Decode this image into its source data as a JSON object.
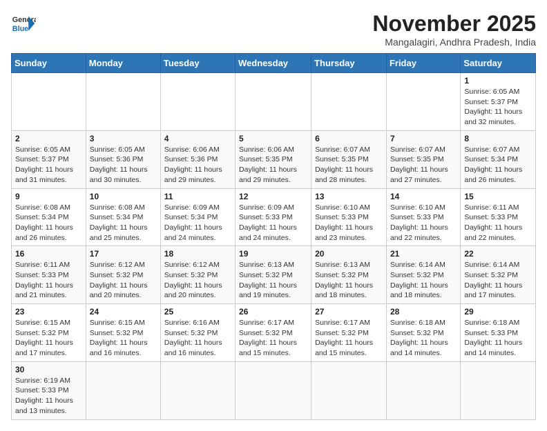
{
  "header": {
    "logo_text_general": "General",
    "logo_text_blue": "Blue",
    "month_title": "November 2025",
    "location": "Mangalagiri, Andhra Pradesh, India"
  },
  "weekdays": [
    "Sunday",
    "Monday",
    "Tuesday",
    "Wednesday",
    "Thursday",
    "Friday",
    "Saturday"
  ],
  "weeks": [
    [
      {
        "day": "",
        "info": ""
      },
      {
        "day": "",
        "info": ""
      },
      {
        "day": "",
        "info": ""
      },
      {
        "day": "",
        "info": ""
      },
      {
        "day": "",
        "info": ""
      },
      {
        "day": "",
        "info": ""
      },
      {
        "day": "1",
        "info": "Sunrise: 6:05 AM\nSunset: 5:37 PM\nDaylight: 11 hours and 32 minutes."
      }
    ],
    [
      {
        "day": "2",
        "info": "Sunrise: 6:05 AM\nSunset: 5:37 PM\nDaylight: 11 hours and 31 minutes."
      },
      {
        "day": "3",
        "info": "Sunrise: 6:05 AM\nSunset: 5:36 PM\nDaylight: 11 hours and 30 minutes."
      },
      {
        "day": "4",
        "info": "Sunrise: 6:06 AM\nSunset: 5:36 PM\nDaylight: 11 hours and 29 minutes."
      },
      {
        "day": "5",
        "info": "Sunrise: 6:06 AM\nSunset: 5:35 PM\nDaylight: 11 hours and 29 minutes."
      },
      {
        "day": "6",
        "info": "Sunrise: 6:07 AM\nSunset: 5:35 PM\nDaylight: 11 hours and 28 minutes."
      },
      {
        "day": "7",
        "info": "Sunrise: 6:07 AM\nSunset: 5:35 PM\nDaylight: 11 hours and 27 minutes."
      },
      {
        "day": "8",
        "info": "Sunrise: 6:07 AM\nSunset: 5:34 PM\nDaylight: 11 hours and 26 minutes."
      }
    ],
    [
      {
        "day": "9",
        "info": "Sunrise: 6:08 AM\nSunset: 5:34 PM\nDaylight: 11 hours and 26 minutes."
      },
      {
        "day": "10",
        "info": "Sunrise: 6:08 AM\nSunset: 5:34 PM\nDaylight: 11 hours and 25 minutes."
      },
      {
        "day": "11",
        "info": "Sunrise: 6:09 AM\nSunset: 5:34 PM\nDaylight: 11 hours and 24 minutes."
      },
      {
        "day": "12",
        "info": "Sunrise: 6:09 AM\nSunset: 5:33 PM\nDaylight: 11 hours and 24 minutes."
      },
      {
        "day": "13",
        "info": "Sunrise: 6:10 AM\nSunset: 5:33 PM\nDaylight: 11 hours and 23 minutes."
      },
      {
        "day": "14",
        "info": "Sunrise: 6:10 AM\nSunset: 5:33 PM\nDaylight: 11 hours and 22 minutes."
      },
      {
        "day": "15",
        "info": "Sunrise: 6:11 AM\nSunset: 5:33 PM\nDaylight: 11 hours and 22 minutes."
      }
    ],
    [
      {
        "day": "16",
        "info": "Sunrise: 6:11 AM\nSunset: 5:33 PM\nDaylight: 11 hours and 21 minutes."
      },
      {
        "day": "17",
        "info": "Sunrise: 6:12 AM\nSunset: 5:32 PM\nDaylight: 11 hours and 20 minutes."
      },
      {
        "day": "18",
        "info": "Sunrise: 6:12 AM\nSunset: 5:32 PM\nDaylight: 11 hours and 20 minutes."
      },
      {
        "day": "19",
        "info": "Sunrise: 6:13 AM\nSunset: 5:32 PM\nDaylight: 11 hours and 19 minutes."
      },
      {
        "day": "20",
        "info": "Sunrise: 6:13 AM\nSunset: 5:32 PM\nDaylight: 11 hours and 18 minutes."
      },
      {
        "day": "21",
        "info": "Sunrise: 6:14 AM\nSunset: 5:32 PM\nDaylight: 11 hours and 18 minutes."
      },
      {
        "day": "22",
        "info": "Sunrise: 6:14 AM\nSunset: 5:32 PM\nDaylight: 11 hours and 17 minutes."
      }
    ],
    [
      {
        "day": "23",
        "info": "Sunrise: 6:15 AM\nSunset: 5:32 PM\nDaylight: 11 hours and 17 minutes."
      },
      {
        "day": "24",
        "info": "Sunrise: 6:15 AM\nSunset: 5:32 PM\nDaylight: 11 hours and 16 minutes."
      },
      {
        "day": "25",
        "info": "Sunrise: 6:16 AM\nSunset: 5:32 PM\nDaylight: 11 hours and 16 minutes."
      },
      {
        "day": "26",
        "info": "Sunrise: 6:17 AM\nSunset: 5:32 PM\nDaylight: 11 hours and 15 minutes."
      },
      {
        "day": "27",
        "info": "Sunrise: 6:17 AM\nSunset: 5:32 PM\nDaylight: 11 hours and 15 minutes."
      },
      {
        "day": "28",
        "info": "Sunrise: 6:18 AM\nSunset: 5:32 PM\nDaylight: 11 hours and 14 minutes."
      },
      {
        "day": "29",
        "info": "Sunrise: 6:18 AM\nSunset: 5:33 PM\nDaylight: 11 hours and 14 minutes."
      }
    ],
    [
      {
        "day": "30",
        "info": "Sunrise: 6:19 AM\nSunset: 5:33 PM\nDaylight: 11 hours and 13 minutes."
      },
      {
        "day": "",
        "info": ""
      },
      {
        "day": "",
        "info": ""
      },
      {
        "day": "",
        "info": ""
      },
      {
        "day": "",
        "info": ""
      },
      {
        "day": "",
        "info": ""
      },
      {
        "day": "",
        "info": ""
      }
    ]
  ]
}
